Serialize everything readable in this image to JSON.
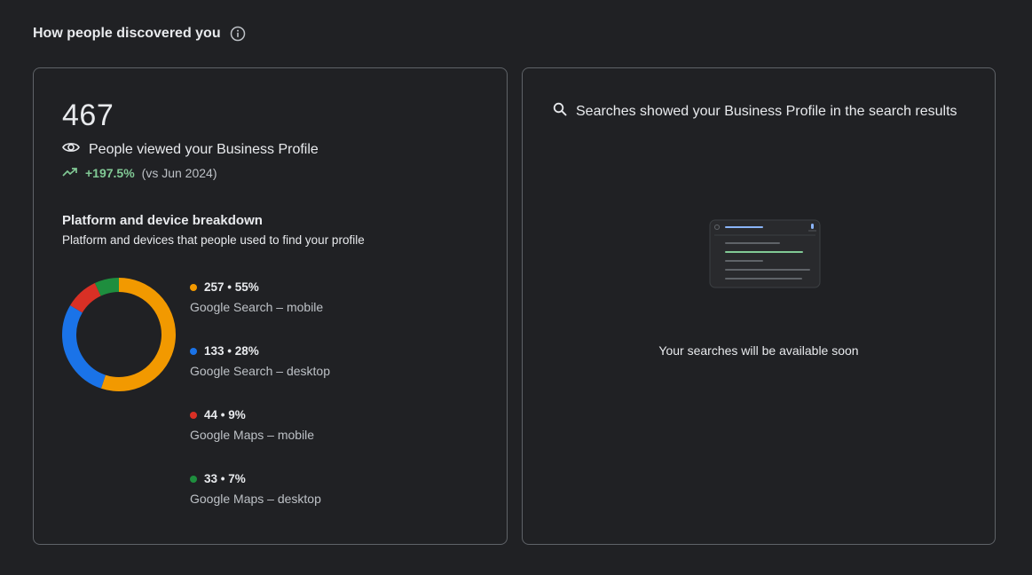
{
  "section": {
    "title": "How people discovered you"
  },
  "profile_views": {
    "count": "467",
    "label": "People viewed your Business Profile",
    "trend_pct": "+197.5%",
    "trend_vs": "(vs Jun 2024)"
  },
  "breakdown": {
    "title": "Platform and device breakdown",
    "subtitle": "Platform and devices that people used to find your profile",
    "items": [
      {
        "head": "257 • 55%",
        "desc": "Google Search – mobile",
        "color": "#f29900"
      },
      {
        "head": "133 • 28%",
        "desc": "Google Search – desktop",
        "color": "#1a73e8"
      },
      {
        "head": "44 • 9%",
        "desc": "Google Maps – mobile",
        "color": "#d93025"
      },
      {
        "head": "33 • 7%",
        "desc": "Google Maps – desktop",
        "color": "#1e8e3e"
      }
    ]
  },
  "chart_data": {
    "type": "pie",
    "categories": [
      "Google Search – mobile",
      "Google Search – desktop",
      "Google Maps – mobile",
      "Google Maps – desktop"
    ],
    "values": [
      257,
      133,
      44,
      33
    ],
    "colors": [
      "#f29900",
      "#1a73e8",
      "#d93025",
      "#1e8e3e"
    ]
  },
  "searches": {
    "title": "Searches showed your Business Profile in the search results",
    "empty_message": "Your searches will be available soon"
  },
  "icons": {
    "info": "info-icon",
    "eye": "eye-icon",
    "trend": "trending-up-icon",
    "search": "search-icon"
  }
}
